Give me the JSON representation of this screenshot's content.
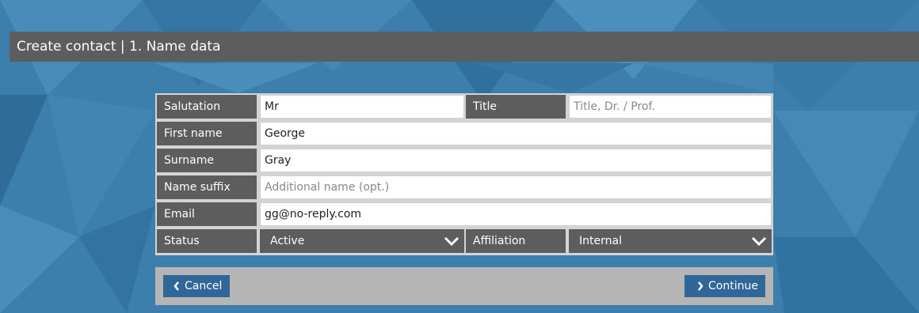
{
  "header": {
    "title": "Create contact | 1. Name data"
  },
  "form": {
    "salutation": {
      "label": "Salutation",
      "value": "Mr"
    },
    "title": {
      "label": "Title",
      "value": "",
      "placeholder": "Title, Dr. / Prof."
    },
    "first_name": {
      "label": "First name",
      "value": "George"
    },
    "surname": {
      "label": "Surname",
      "value": "Gray"
    },
    "name_suffix": {
      "label": "Name suffix",
      "value": "",
      "placeholder": "Additional name (opt.)"
    },
    "email": {
      "label": "Email",
      "value": "gg@no-reply.com"
    },
    "status": {
      "label": "Status",
      "value": "Active",
      "icon": "chevron-down-icon"
    },
    "affiliation": {
      "label": "Affiliation",
      "value": "Internal",
      "icon": "chevron-down-icon"
    }
  },
  "footer": {
    "cancel_label": "Cancel",
    "cancel_icon": "chevron-left-icon",
    "continue_label": "Continue",
    "continue_icon": "chevron-right-icon"
  },
  "colors": {
    "background": "#3c7fad",
    "header": "#5d5d5d",
    "label_bg": "#5d5d5d",
    "button": "#2f6798",
    "button_bar": "#b5b5b5"
  }
}
